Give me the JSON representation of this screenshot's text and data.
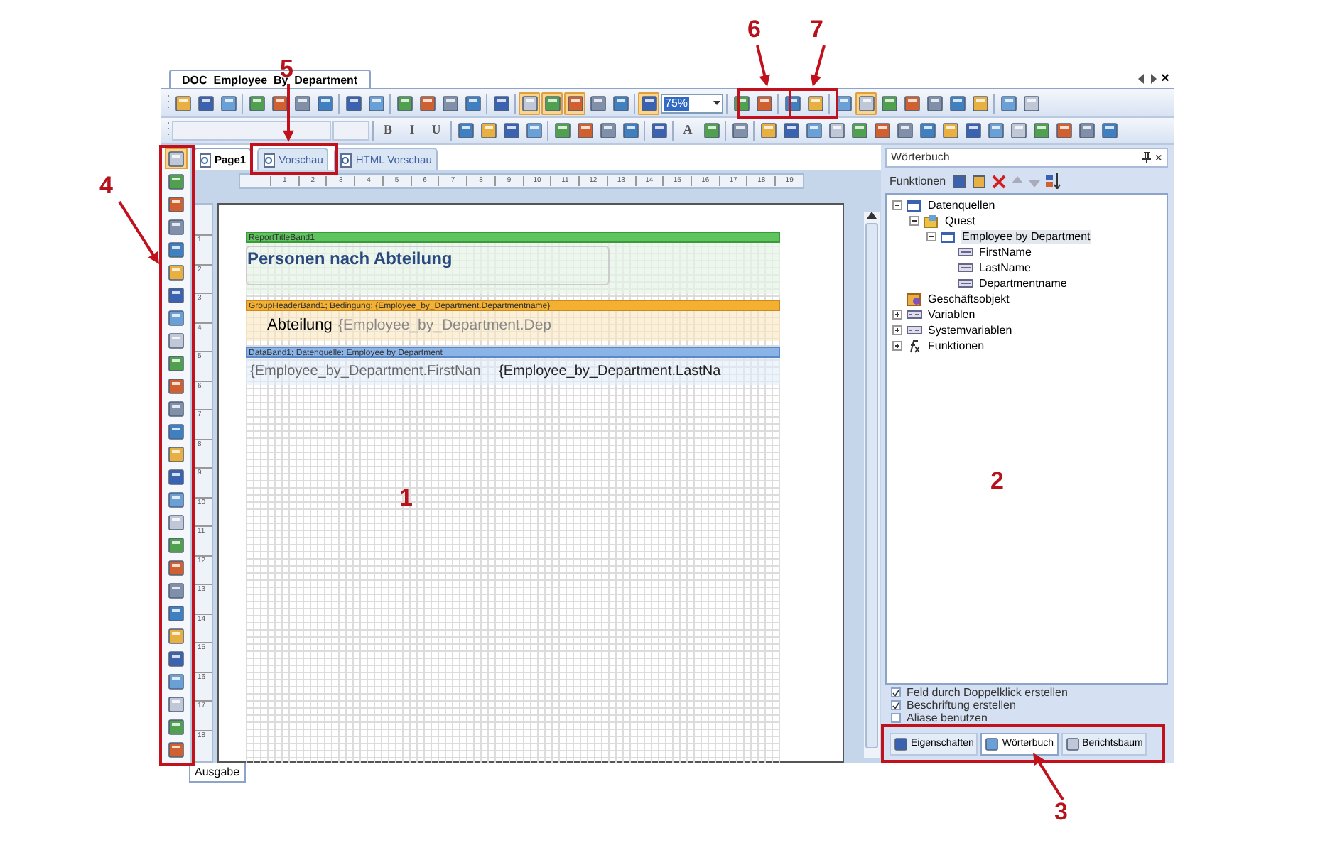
{
  "window": {
    "document_tab": "DOC_Employee_By_Department",
    "close": "×"
  },
  "toolbar_1": [
    {
      "kind": "button",
      "selected": false
    },
    {
      "kind": "button",
      "selected": false
    },
    {
      "kind": "button",
      "selected": false
    },
    {
      "kind": "separator"
    },
    {
      "kind": "button",
      "selected": false
    },
    {
      "kind": "button",
      "selected": false
    },
    {
      "kind": "button",
      "selected": false
    },
    {
      "kind": "button",
      "selected": false
    },
    {
      "kind": "separator"
    },
    {
      "kind": "button",
      "selected": false
    },
    {
      "kind": "button",
      "selected": false
    },
    {
      "kind": "separator"
    },
    {
      "kind": "button",
      "selected": false
    },
    {
      "kind": "button",
      "selected": false
    },
    {
      "kind": "button",
      "selected": false
    },
    {
      "kind": "button",
      "selected": false
    },
    {
      "kind": "separator"
    },
    {
      "kind": "button",
      "selected": false
    },
    {
      "kind": "separator"
    },
    {
      "kind": "button",
      "selected": true
    },
    {
      "kind": "button",
      "selected": true
    },
    {
      "kind": "button",
      "selected": true
    },
    {
      "kind": "button",
      "selected": false
    },
    {
      "kind": "button",
      "selected": false
    },
    {
      "kind": "separator"
    },
    {
      "kind": "button",
      "selected": true
    },
    {
      "kind": "zoom",
      "value": "75%"
    },
    {
      "kind": "separator"
    },
    {
      "kind": "button",
      "selected": false
    },
    {
      "kind": "button",
      "selected": false
    },
    {
      "kind": "separator"
    },
    {
      "kind": "button",
      "selected": false
    },
    {
      "kind": "button",
      "selected": false
    },
    {
      "kind": "separator"
    },
    {
      "kind": "button",
      "selected": false
    },
    {
      "kind": "button",
      "selected": true
    },
    {
      "kind": "button",
      "selected": false
    },
    {
      "kind": "button",
      "selected": false
    },
    {
      "kind": "button",
      "selected": false
    },
    {
      "kind": "button",
      "selected": false
    },
    {
      "kind": "button",
      "selected": false
    },
    {
      "kind": "separator"
    },
    {
      "kind": "button",
      "selected": false
    },
    {
      "kind": "button",
      "selected": false
    }
  ],
  "toolbar_2": [
    {
      "kind": "field"
    },
    {
      "kind": "smallfield"
    },
    {
      "kind": "separator"
    },
    {
      "kind": "letter",
      "label": "B"
    },
    {
      "kind": "letter",
      "label": "I"
    },
    {
      "kind": "letter",
      "label": "U"
    },
    {
      "kind": "separator"
    },
    {
      "kind": "button"
    },
    {
      "kind": "button"
    },
    {
      "kind": "button"
    },
    {
      "kind": "button"
    },
    {
      "kind": "separator"
    },
    {
      "kind": "button"
    },
    {
      "kind": "button"
    },
    {
      "kind": "button"
    },
    {
      "kind": "button"
    },
    {
      "kind": "separator"
    },
    {
      "kind": "button"
    },
    {
      "kind": "separator"
    },
    {
      "kind": "letter",
      "label": "A"
    },
    {
      "kind": "button"
    },
    {
      "kind": "separator"
    },
    {
      "kind": "button"
    },
    {
      "kind": "separator"
    },
    {
      "kind": "button"
    },
    {
      "kind": "button"
    },
    {
      "kind": "button"
    },
    {
      "kind": "button"
    },
    {
      "kind": "button"
    },
    {
      "kind": "button"
    },
    {
      "kind": "button"
    },
    {
      "kind": "button"
    },
    {
      "kind": "button"
    },
    {
      "kind": "button"
    },
    {
      "kind": "button"
    },
    {
      "kind": "button"
    },
    {
      "kind": "button"
    },
    {
      "kind": "button"
    },
    {
      "kind": "button"
    },
    {
      "kind": "button"
    }
  ],
  "toolbox": [
    {
      "selected": true
    },
    {
      "selected": false
    },
    {
      "selected": false
    },
    {
      "selected": false
    },
    {
      "selected": false
    },
    {
      "selected": false
    },
    {
      "selected": false
    },
    {
      "selected": false
    },
    {
      "selected": false
    },
    {
      "selected": false
    },
    {
      "selected": false
    },
    {
      "selected": false
    },
    {
      "selected": false
    },
    {
      "selected": false
    },
    {
      "selected": false
    },
    {
      "selected": false
    },
    {
      "selected": false
    },
    {
      "selected": false
    },
    {
      "selected": false
    },
    {
      "selected": false
    },
    {
      "selected": false
    },
    {
      "selected": false
    },
    {
      "selected": false
    },
    {
      "selected": false
    },
    {
      "selected": false
    },
    {
      "selected": false
    },
    {
      "selected": false
    }
  ],
  "design_tabs": [
    {
      "label": "Page1",
      "selected": true
    },
    {
      "label": "Vorschau",
      "selected": false
    },
    {
      "label": "HTML Vorschau",
      "selected": false
    }
  ],
  "ruler_h": [
    "1",
    "2",
    "3",
    "4",
    "5",
    "6",
    "7",
    "8",
    "9",
    "10",
    "11",
    "12",
    "13",
    "14",
    "15",
    "16",
    "17",
    "18",
    "19"
  ],
  "ruler_v": [
    "1",
    "2",
    "3",
    "4",
    "5",
    "6",
    "7",
    "8",
    "9",
    "10",
    "11",
    "12",
    "13",
    "14",
    "15",
    "16",
    "17",
    "18"
  ],
  "bands": [
    {
      "kind": "title",
      "header": "ReportTitleBand1",
      "texts": [
        "Personen nach Abteilung"
      ]
    },
    {
      "kind": "group",
      "header": "GroupHeaderBand1; Bedingung: {Employee_by_Department.Departmentname}",
      "texts": [
        "Abteilung",
        "{Employee_by_Department.Dep"
      ]
    },
    {
      "kind": "data",
      "header": "DataBand1; Datenquelle: Employee by Department",
      "texts": [
        "{Employee_by_Department.FirstNan",
        "{Employee_by_Department.LastNa"
      ]
    }
  ],
  "dictionary": {
    "title": "Wörterbuch",
    "close": "×",
    "toolbar_label": "Funktionen",
    "tree": [
      {
        "label": "Datenquellen",
        "kind": "table",
        "expanded": true,
        "children": [
          {
            "label": "Quest",
            "kind": "database",
            "expanded": true,
            "children": [
              {
                "label": "Employee by Department",
                "kind": "table",
                "expanded": true,
                "selected": true,
                "children": [
                  {
                    "label": "FirstName",
                    "kind": "field"
                  },
                  {
                    "label": "LastName",
                    "kind": "field"
                  },
                  {
                    "label": "Departmentname",
                    "kind": "field"
                  }
                ]
              }
            ]
          }
        ]
      },
      {
        "label": "Geschäftsobjekt",
        "kind": "object"
      },
      {
        "label": "Variablen",
        "kind": "variables",
        "expanded": false
      },
      {
        "label": "Systemvariablen",
        "kind": "variables",
        "expanded": false
      },
      {
        "label": "Funktionen",
        "kind": "function",
        "expanded": false
      }
    ],
    "options": [
      {
        "label": "Feld durch Doppelklick erstellen",
        "checked": true
      },
      {
        "label": "Beschriftung erstellen",
        "checked": true
      },
      {
        "label": "Aliase benutzen",
        "checked": false
      }
    ],
    "tabs": [
      {
        "label": "Eigenschaften",
        "selected": false
      },
      {
        "label": "Wörterbuch",
        "selected": true
      },
      {
        "label": "Berichtsbaum",
        "selected": false
      }
    ]
  },
  "output_tab": "Ausgabe",
  "annotations": [
    {
      "label": "5"
    },
    {
      "label": "6"
    },
    {
      "label": "7"
    },
    {
      "label": "4"
    },
    {
      "label": "1"
    },
    {
      "label": "2"
    },
    {
      "label": "3"
    }
  ]
}
